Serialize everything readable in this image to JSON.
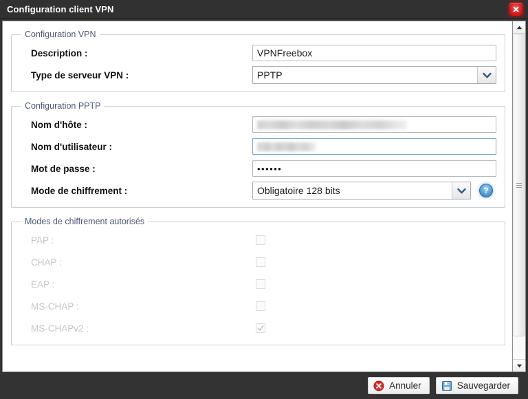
{
  "window": {
    "title": "Configuration client VPN",
    "close_icon": "close-icon"
  },
  "groups": [
    {
      "legend": "Configuration VPN",
      "rows": [
        {
          "label": "Description :",
          "type": "text",
          "value": "VPNFreebox"
        },
        {
          "label": "Type de serveur VPN :",
          "type": "select",
          "value": "PPTP"
        }
      ]
    },
    {
      "legend": "Configuration PPTP",
      "rows": [
        {
          "label": "Nom d'hôte :",
          "type": "text",
          "value": "",
          "redacted": true
        },
        {
          "label": "Nom d'utilisateur :",
          "type": "text",
          "value": "",
          "redacted": true,
          "focused": true
        },
        {
          "label": "Mot de passe :",
          "type": "password",
          "value": "••••••"
        },
        {
          "label": "Mode de chiffrement :",
          "type": "select",
          "value": "Obligatoire 128 bits",
          "help": "?"
        }
      ]
    },
    {
      "legend": "Modes de chiffrement autorisés",
      "rows": [
        {
          "label": "PAP :",
          "type": "checkbox",
          "checked": false,
          "disabled": true
        },
        {
          "label": "CHAP :",
          "type": "checkbox",
          "checked": false,
          "disabled": true
        },
        {
          "label": "EAP :",
          "type": "checkbox",
          "checked": false,
          "disabled": true
        },
        {
          "label": "MS-CHAP :",
          "type": "checkbox",
          "checked": false,
          "disabled": true
        },
        {
          "label": "MS-CHAPv2 :",
          "type": "checkbox",
          "checked": true,
          "disabled": true
        }
      ]
    }
  ],
  "scrollbar": {
    "up_icon": "triangle-up-icon",
    "down_icon": "triangle-down-icon"
  },
  "footer": {
    "cancel_label": "Annuler",
    "cancel_icon": "error-x-icon",
    "save_label": "Sauvegarder",
    "save_icon": "floppy-disk-icon"
  },
  "colors": {
    "titlebar_bg": "#313131",
    "footer_bg": "#333333",
    "legend_text": "#4a5a78",
    "close_red": "#e01c1c",
    "help_blue": "#3076b4",
    "accent_focus": "#7aa7cc"
  }
}
